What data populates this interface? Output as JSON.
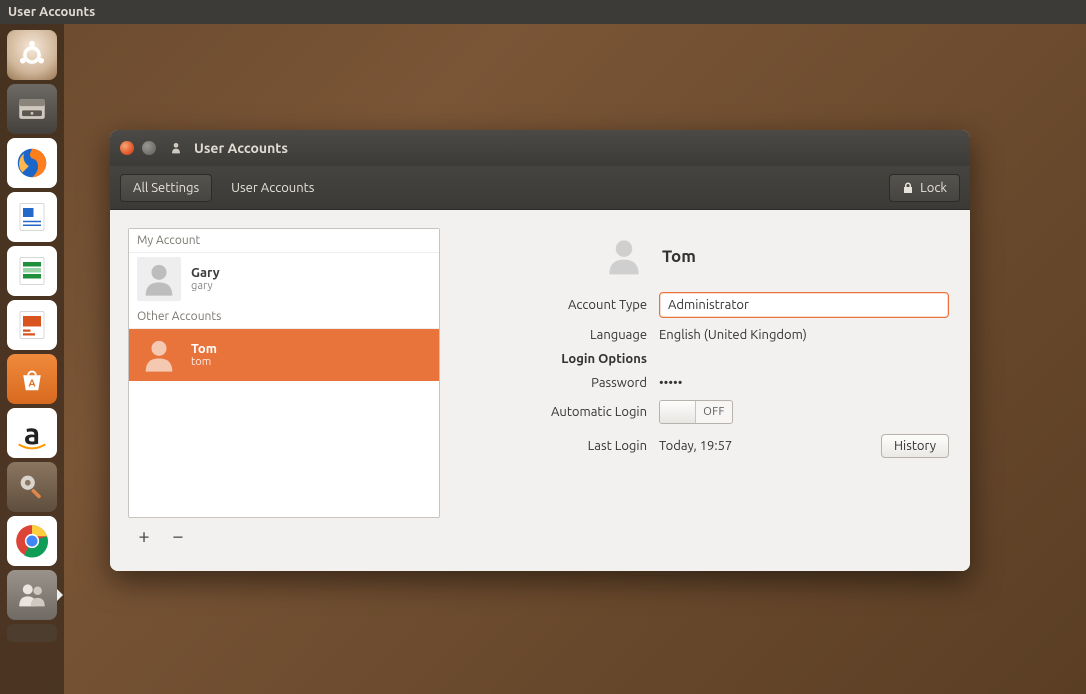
{
  "menubar": {
    "title": "User Accounts"
  },
  "launcher": {
    "items": [
      {
        "name": "dash"
      },
      {
        "name": "files"
      },
      {
        "name": "firefox"
      },
      {
        "name": "writer"
      },
      {
        "name": "calc"
      },
      {
        "name": "impress"
      },
      {
        "name": "software"
      },
      {
        "name": "amazon"
      },
      {
        "name": "settings"
      },
      {
        "name": "chrome"
      },
      {
        "name": "users"
      }
    ]
  },
  "window": {
    "title": "User Accounts",
    "toolbar": {
      "all_settings": "All Settings",
      "breadcrumb": "User Accounts",
      "lock": "Lock"
    }
  },
  "userlist": {
    "my_account_header": "My Account",
    "other_accounts_header": "Other Accounts",
    "users": [
      {
        "display": "Gary",
        "username": "gary",
        "selected": false
      },
      {
        "display": "Tom",
        "username": "tom",
        "selected": true
      }
    ],
    "add_label": "+",
    "remove_label": "−"
  },
  "detail": {
    "name": "Tom",
    "labels": {
      "account_type": "Account Type",
      "language": "Language",
      "login_options": "Login Options",
      "password": "Password",
      "automatic_login": "Automatic Login",
      "last_login": "Last Login"
    },
    "values": {
      "account_type": "Administrator",
      "language": "English (United Kingdom)",
      "password": "•••••",
      "automatic_login_state": "OFF",
      "last_login": "Today, 19:57"
    },
    "history_button": "History"
  }
}
